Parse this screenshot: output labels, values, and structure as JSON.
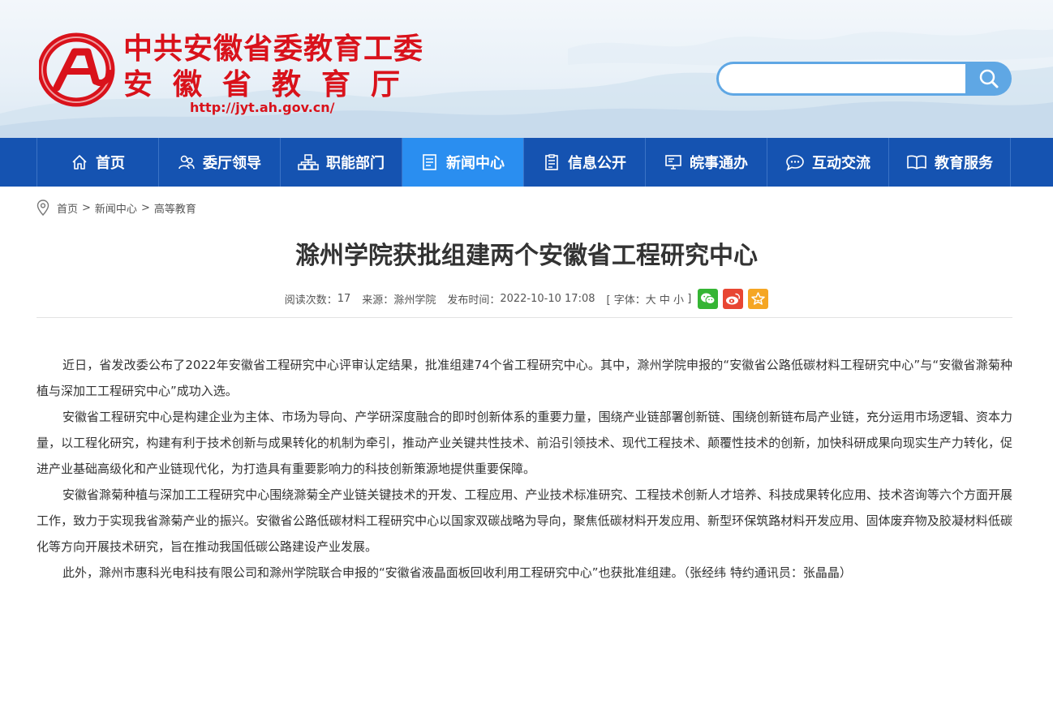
{
  "header": {
    "org_line1": "中共安徽省委教育工委",
    "org_line2": "安徽省教育厅",
    "url": "http://jyt.ah.gov.cn/",
    "logo_icon": "e-globe-logo-icon",
    "brand_red": "#d9121b",
    "search": {
      "value": "",
      "placeholder": "",
      "icon": "search-icon",
      "accent": "#5fa7e4"
    }
  },
  "nav": {
    "bg": "#1553b1",
    "active_bg": "#2a8ef0",
    "items": [
      {
        "label": "首页",
        "icon": "home-icon"
      },
      {
        "label": "委厅领导",
        "icon": "people-icon"
      },
      {
        "label": "职能部门",
        "icon": "org-chart-icon"
      },
      {
        "label": "新闻中心",
        "icon": "news-doc-icon",
        "active": true
      },
      {
        "label": "信息公开",
        "icon": "clipboard-icon"
      },
      {
        "label": "皖事通办",
        "icon": "monitor-icon"
      },
      {
        "label": "互动交流",
        "icon": "chat-icon"
      },
      {
        "label": "教育服务",
        "icon": "open-book-icon"
      }
    ]
  },
  "breadcrumb": {
    "icon": "location-pin-icon",
    "items": [
      "首页",
      "新闻中心",
      "高等教育"
    ],
    "separator": ">"
  },
  "article": {
    "title": "滁州学院获批组建两个安徽省工程研究中心",
    "meta": {
      "reads_label": "阅读次数：",
      "reads_value": "17",
      "source_label": "来源：",
      "source_value": "滁州学院",
      "time_label": "发布时间：",
      "time_value": "2022-10-10 17:08",
      "font_open": "[ 字体：",
      "font_large": "大",
      "font_medium": "中",
      "font_small": "小",
      "font_close": "]"
    },
    "share": [
      {
        "icon": "wechat-icon",
        "color": "#35b534"
      },
      {
        "icon": "weibo-icon",
        "color": "#e84632"
      },
      {
        "icon": "favorite-star-icon",
        "color": "#f5a623"
      }
    ],
    "paragraphs": [
      "近日，省发改委公布了2022年安徽省工程研究中心评审认定结果，批准组建74个省工程研究中心。其中，滁州学院申报的“安徽省公路低碳材料工程研究中心”与“安徽省滁菊种植与深加工工程研究中心”成功入选。",
      "安徽省工程研究中心是构建企业为主体、市场为导向、产学研深度融合的即时创新体系的重要力量，围绕产业链部署创新链、围绕创新链布局产业链，充分运用市场逻辑、资本力量，以工程化研究，构建有利于技术创新与成果转化的机制为牵引，推动产业关键共性技术、前沿引领技术、现代工程技术、颠覆性技术的创新，加快科研成果向现实生产力转化，促进产业基础高级化和产业链现代化，为打造具有重要影响力的科技创新策源地提供重要保障。",
      "安徽省滁菊种植与深加工工程研究中心围绕滁菊全产业链关键技术的开发、工程应用、产业技术标准研究、工程技术创新人才培养、科技成果转化应用、技术咨询等六个方面开展工作，致力于实现我省滁菊产业的振兴。安徽省公路低碳材料工程研究中心以国家双碳战略为导向，聚焦低碳材料开发应用、新型环保筑路材料开发应用、固体废弃物及胶凝材料低碳化等方向开展技术研究，旨在推动我国低碳公路建设产业发展。",
      "此外，滁州市惠科光电科技有限公司和滁州学院联合申报的“安徽省液晶面板回收利用工程研究中心”也获批准组建。（张经纬 特约通讯员：张晶晶）"
    ]
  }
}
